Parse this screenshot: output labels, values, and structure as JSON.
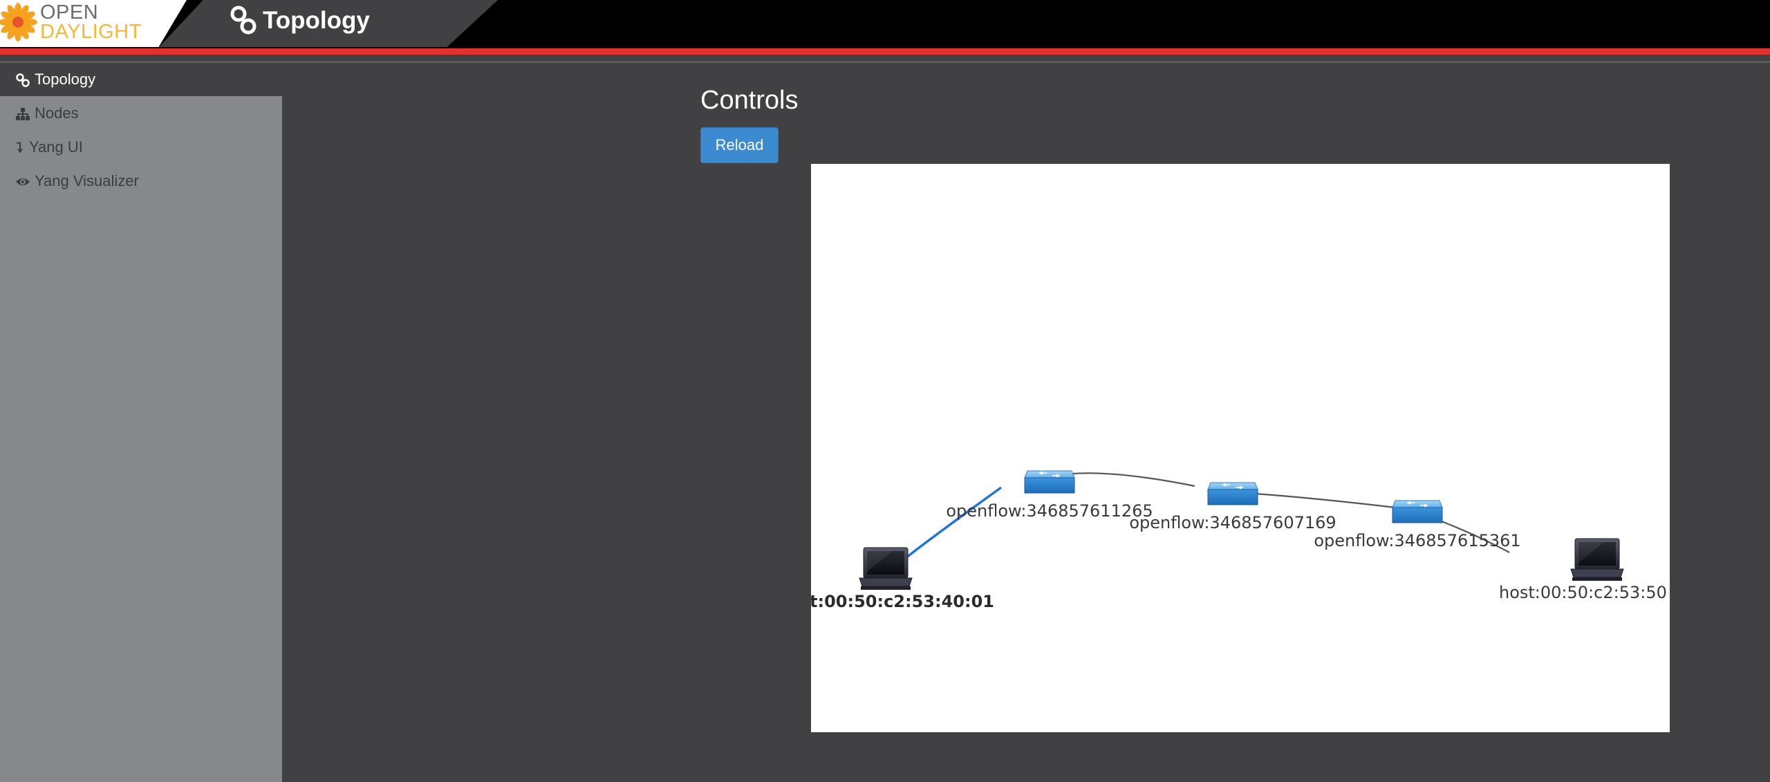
{
  "header": {
    "logo": {
      "line1": "OPEN",
      "line2": "DAYLIGHT",
      "flower_color": "#f6a21f",
      "text_color_line1": "#6b6b6b",
      "text_color_line2": "#f6b734"
    },
    "title": "Topology",
    "title_icon": "link-icon",
    "accent_color": "#e4312c"
  },
  "sidebar": {
    "items": [
      {
        "label": "Topology",
        "icon": "link-icon",
        "active": true
      },
      {
        "label": "Nodes",
        "icon": "sitemap-icon",
        "active": false
      },
      {
        "label": "Yang UI",
        "icon": "arrow-down-icon",
        "active": false
      },
      {
        "label": "Yang Visualizer",
        "icon": "eye-icon",
        "active": false
      }
    ]
  },
  "main": {
    "title": "Controls",
    "reload_label": "Reload",
    "reload_color": "#3c8ad0"
  },
  "topology": {
    "nodes": [
      {
        "id": "openflow:346857611265",
        "type": "switch",
        "label": "openflow:346857611265"
      },
      {
        "id": "openflow:346857607169",
        "type": "switch",
        "label": "openflow:346857607169"
      },
      {
        "id": "openflow:346857615361",
        "type": "switch",
        "label": "openflow:346857615361"
      },
      {
        "id": "host-left",
        "type": "host",
        "label": "t:00:50:c2:53:40:01",
        "highlighted": true
      },
      {
        "id": "host-right",
        "type": "host",
        "label": "host:00:50:c2:53:50"
      }
    ],
    "links": [
      {
        "from": "host-left",
        "to": "openflow:346857611265",
        "color": "#1f74e0"
      },
      {
        "from": "openflow:346857611265",
        "to": "openflow:346857607169",
        "color": "#555555"
      },
      {
        "from": "openflow:346857607169",
        "to": "openflow:346857615361",
        "color": "#555555"
      },
      {
        "from": "openflow:346857615361",
        "to": "host-right",
        "color": "#555555"
      }
    ]
  }
}
